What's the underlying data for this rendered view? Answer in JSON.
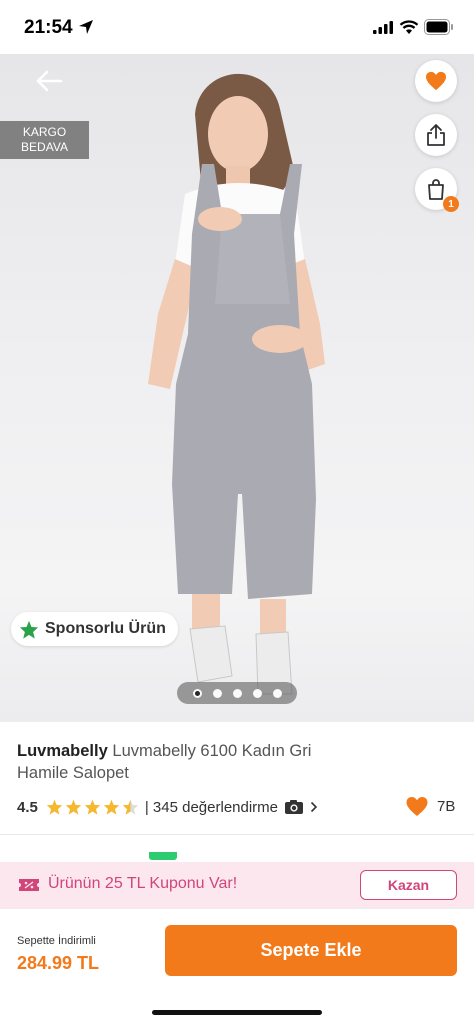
{
  "status_bar": {
    "time": "21:54",
    "icons": [
      "location-arrow-icon",
      "signal-icon",
      "wifi-icon",
      "battery-icon"
    ]
  },
  "hero": {
    "badge": "KARGO BEDAVA",
    "badge_lines": [
      "KARGO",
      "BEDAVA"
    ],
    "sponsored_label": "Sponsorlu Ürün",
    "image_count": 5,
    "active_image_index": 0,
    "cart_badge_count": "1",
    "icons": {
      "back": "arrow-left-icon",
      "favorite": "heart-icon",
      "share": "share-icon",
      "cart": "shopping-bag-icon",
      "sponsor": "star-icon"
    }
  },
  "product": {
    "brand": "Luvmabelly",
    "name": "Luvmabelly 6100 Kadın Gri Hamile Salopet",
    "rating": "4.5",
    "rating_value": 4.5,
    "reviews_text": "| 345 değerlendirme",
    "likes": "7B"
  },
  "coupon": {
    "text": "Ürünün 25 TL Kuponu Var!",
    "button": "Kazan"
  },
  "bottom_bar": {
    "price_label": "Sepette İndirimli",
    "price": "284.99 TL",
    "add_to_cart": "Sepete Ekle"
  },
  "colors": {
    "accent": "#f27a1a",
    "coupon_pink": "#d0457a",
    "coupon_bg": "#fde7ee",
    "star": "#f5b82e",
    "sponsor_star": "#2aa24a"
  }
}
